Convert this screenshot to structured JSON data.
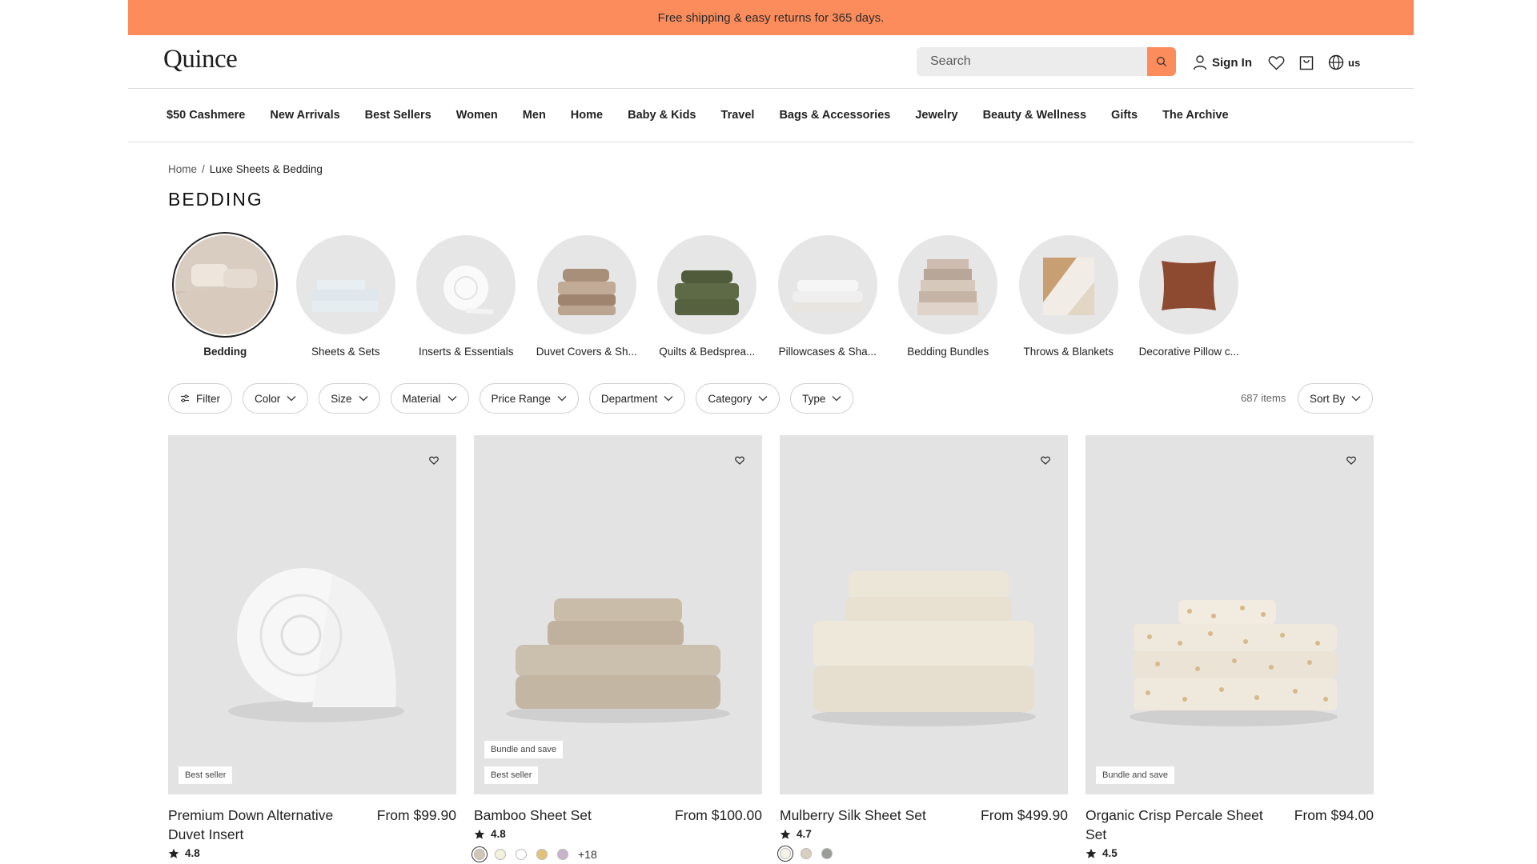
{
  "promo": {
    "text": "Free shipping & easy returns for 365 days."
  },
  "header": {
    "logo": "Quince",
    "search_placeholder": "Search",
    "sign_in": "Sign In",
    "region": "us"
  },
  "nav": {
    "items": [
      "$50 Cashmere",
      "New Arrivals",
      "Best Sellers",
      "Women",
      "Men",
      "Home",
      "Baby & Kids",
      "Travel",
      "Bags & Accessories",
      "Jewelry",
      "Beauty & Wellness",
      "Gifts",
      "The Archive"
    ]
  },
  "breadcrumb": {
    "home": "Home",
    "separator": "/",
    "current": "Luxe Sheets & Bedding"
  },
  "page_title": "BEDDING",
  "categories": [
    {
      "label": "Bedding",
      "icon": "bedding-image"
    },
    {
      "label": "Sheets & Sets",
      "icon": "sheets-image"
    },
    {
      "label": "Inserts & Essentials",
      "icon": "insert-image"
    },
    {
      "label": "Duvet Covers & Sh...",
      "icon": "duvet-image"
    },
    {
      "label": "Quilts & Bedsprea...",
      "icon": "quilt-image"
    },
    {
      "label": "Pillowcases & Sha...",
      "icon": "pillowcase-image"
    },
    {
      "label": "Bedding Bundles",
      "icon": "bundle-image"
    },
    {
      "label": "Throws & Blankets",
      "icon": "throw-image"
    },
    {
      "label": "Decorative Pillow c...",
      "icon": "pillow-image"
    }
  ],
  "filters": {
    "filter_label": "Filter",
    "dropdowns": [
      "Color",
      "Size",
      "Material",
      "Price Range",
      "Department",
      "Category",
      "Type"
    ],
    "items_count": "687 items",
    "sort_label": "Sort By"
  },
  "products": [
    {
      "name": "Premium Down Alternative Duvet Insert",
      "price": "From $99.90",
      "rating": "4.8",
      "badges": [
        "Best seller"
      ]
    },
    {
      "name": "Bamboo Sheet Set",
      "price": "From $100.00",
      "rating": "4.8",
      "badges": [
        "Bundle and save",
        "Best seller"
      ],
      "swatches": [
        "#cfc6b6",
        "#f3f0dc",
        "#ffffff",
        "#e2c27a",
        "#c8b4c8"
      ],
      "more_colors": "+18"
    },
    {
      "name": "Mulberry Silk Sheet Set",
      "price": "From $499.90",
      "rating": "4.7",
      "badges": [],
      "swatches": [
        "#f4f2e6",
        "#d8cfc0",
        "#9a9d98"
      ]
    },
    {
      "name": "Organic Crisp Percale Sheet Set",
      "price": "From $94.00",
      "rating": "4.5",
      "badges": [
        "Bundle and save"
      ]
    }
  ],
  "colors": {
    "promo_bg": "#fc8c5c",
    "search_button": "#fc8c5c"
  }
}
